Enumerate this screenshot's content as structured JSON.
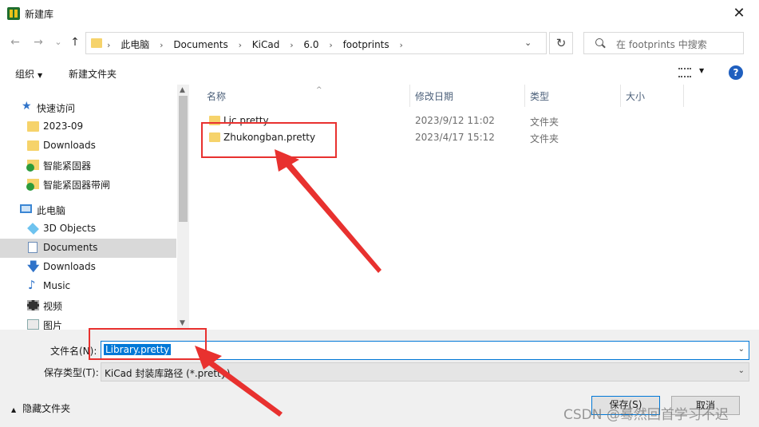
{
  "window": {
    "title": "新建库",
    "close_glyph": "✕"
  },
  "nav": {
    "back_glyph": "←",
    "forward_glyph": "→",
    "recent_glyph": "⌄",
    "up_glyph": "↑",
    "breadcrumbs": [
      "此电脑",
      "Documents",
      "KiCad",
      "6.0",
      "footprints"
    ],
    "crumb_separator": "›",
    "dropdown_glyph": "⌄",
    "refresh_glyph": "↻",
    "search_placeholder": "在 footprints 中搜索"
  },
  "toolbar": {
    "organize": "组织",
    "organize_caret": "▼",
    "new_folder": "新建文件夹",
    "view_caret": "▼",
    "help": "?"
  },
  "sidebar": {
    "items": [
      {
        "label": "快速访问",
        "icon": "star-icon",
        "glyph": "★"
      },
      {
        "label": "2023-09",
        "icon": "folder-icon"
      },
      {
        "label": "Downloads",
        "icon": "folder-icon"
      },
      {
        "label": "智能紧固器",
        "icon": "synced-folder-icon"
      },
      {
        "label": "智能紧固器带闸",
        "icon": "synced-folder-icon"
      },
      {
        "label": "此电脑",
        "icon": "computer-icon"
      },
      {
        "label": "3D Objects",
        "icon": "3d-objects-icon"
      },
      {
        "label": "Documents",
        "icon": "documents-icon",
        "selected": true
      },
      {
        "label": "Downloads",
        "icon": "download-arrow-icon",
        "glyph": "🡇"
      },
      {
        "label": "Music",
        "icon": "music-icon",
        "glyph": "♪"
      },
      {
        "label": "视频",
        "icon": "video-icon"
      },
      {
        "label": "图片",
        "icon": "pictures-icon"
      }
    ],
    "scroll_up": "▲",
    "scroll_down": "▼"
  },
  "columns": {
    "name": "名称",
    "modified": "修改日期",
    "type": "类型",
    "size": "大小",
    "sort_glyph": "^"
  },
  "files": [
    {
      "name": "Ljc.pretty",
      "modified": "2023/9/12 11:02",
      "type": "文件夹"
    },
    {
      "name": "Zhukongban.pretty",
      "modified": "2023/4/17 15:12",
      "type": "文件夹"
    }
  ],
  "form": {
    "filename_label": "文件名(N):",
    "filename_value": "Library.pretty",
    "filetype_label": "保存类型(T):",
    "filetype_value": "KiCad 封装库路径 (*.pretty)",
    "dropdown_glyph": "⌄",
    "hide_folders": "隐藏文件夹",
    "hide_caret": "▲",
    "save_button": "保存(S)",
    "cancel_button": "取消"
  },
  "watermark": "CSDN @蓦然回首学习不迟",
  "colors": {
    "accent": "#0078d7",
    "annotation": "#e8312f",
    "folder": "#f6d36b"
  }
}
